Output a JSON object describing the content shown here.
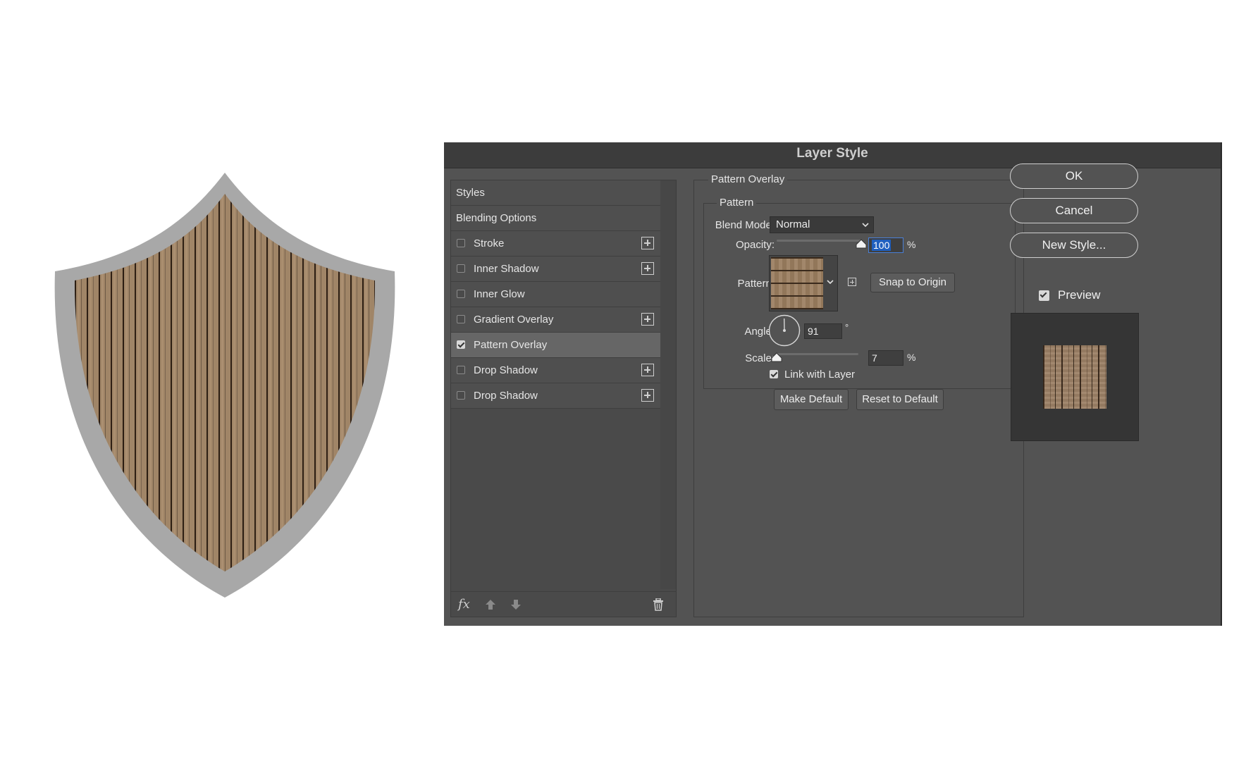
{
  "dialog": {
    "title": "Layer Style",
    "styles_list": [
      {
        "label": "Styles",
        "type": "header"
      },
      {
        "label": "Blending Options",
        "type": "header"
      },
      {
        "label": "Stroke",
        "checked": false,
        "plus": true
      },
      {
        "label": "Inner Shadow",
        "checked": false,
        "plus": true
      },
      {
        "label": "Inner Glow",
        "checked": false,
        "plus": false
      },
      {
        "label": "Gradient Overlay",
        "checked": false,
        "plus": true
      },
      {
        "label": "Pattern Overlay",
        "checked": true,
        "plus": false,
        "selected": true
      },
      {
        "label": "Drop Shadow",
        "checked": false,
        "plus": true
      },
      {
        "label": "Drop Shadow",
        "checked": false,
        "plus": true
      }
    ],
    "footer": {
      "fx_label": "fx"
    },
    "pattern_overlay": {
      "section_title": "Pattern Overlay",
      "group_title": "Pattern",
      "blend_mode_label": "Blend Mode:",
      "blend_mode_value": "Normal",
      "opacity_label": "Opacity:",
      "opacity_value": "100",
      "opacity_unit": "%",
      "opacity_fraction": 1.0,
      "pattern_label": "Pattern:",
      "snap_button": "Snap to Origin",
      "angle_label": "Angle:",
      "angle_value": "91",
      "angle_unit": "°",
      "scale_label": "Scale:",
      "scale_value": "7",
      "scale_unit": "%",
      "scale_fraction": 0.0,
      "link_label": "Link with Layer",
      "link_checked": true,
      "make_default": "Make Default",
      "reset_default": "Reset to Default"
    },
    "actions": {
      "ok": "OK",
      "cancel": "Cancel",
      "new_style": "New Style...",
      "preview_label": "Preview",
      "preview_checked": true
    }
  },
  "colors": {
    "dialog_bg": "#535353",
    "shield_rim": "#a8a8a8",
    "wood": "#9c8166",
    "field_highlight": "#1f5fbf"
  }
}
